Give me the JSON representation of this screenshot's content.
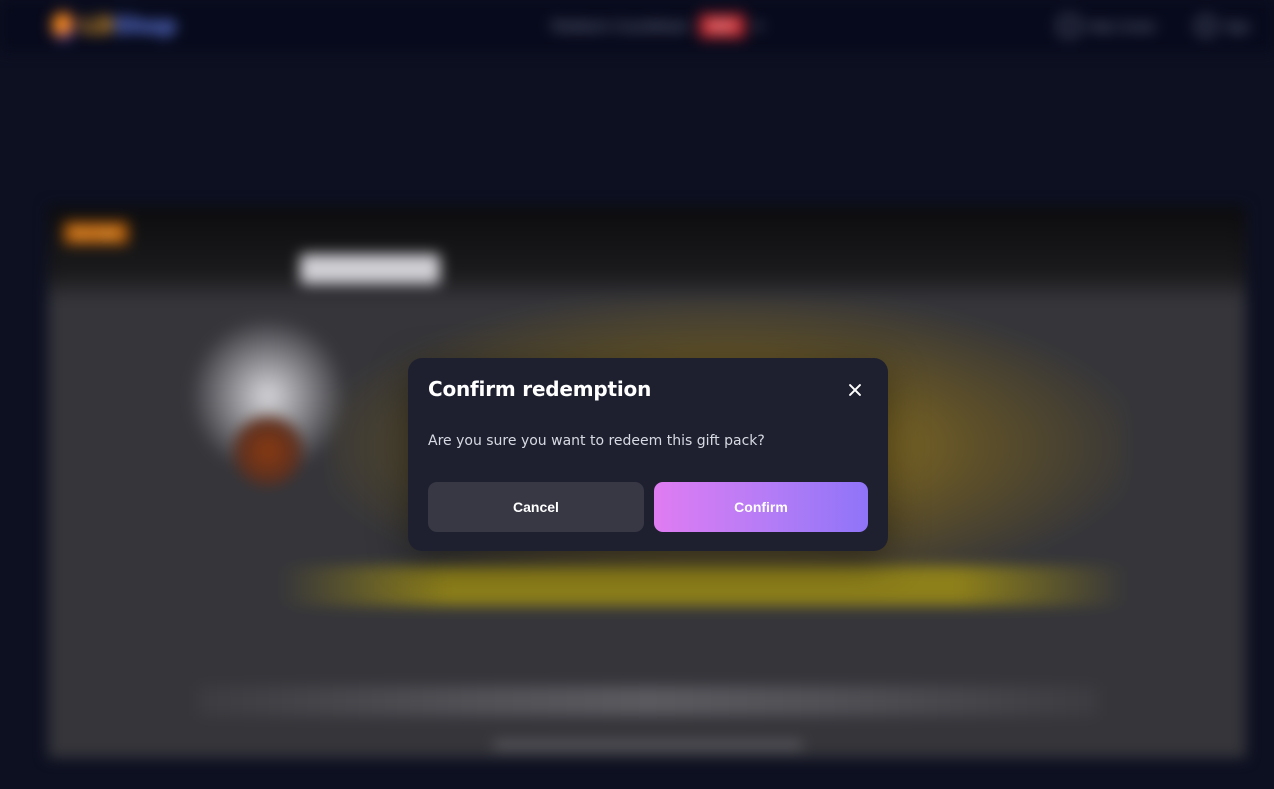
{
  "header": {
    "logo_text_a": "LD",
    "logo_text_b": "Shop",
    "nav_link": "Redeem Countdown",
    "nav_badge": "NEW",
    "help_label": "Help Center",
    "user_label": "Sign"
  },
  "banner": {
    "tag": "Hot Sale"
  },
  "modal": {
    "title": "Confirm redemption",
    "message": "Are you sure you want to redeem this gift pack?",
    "cancel_label": "Cancel",
    "confirm_label": "Confirm"
  },
  "colors": {
    "page_bg": "#0d1021",
    "modal_bg": "#1e2030",
    "cancel_bg": "#373844",
    "confirm_gradient_start": "#e07cf2",
    "confirm_gradient_end": "#8f74f8"
  },
  "icons": {
    "close": "close-icon",
    "help": "headset-icon",
    "user": "user-icon",
    "chevron": "chevron-down-icon"
  }
}
